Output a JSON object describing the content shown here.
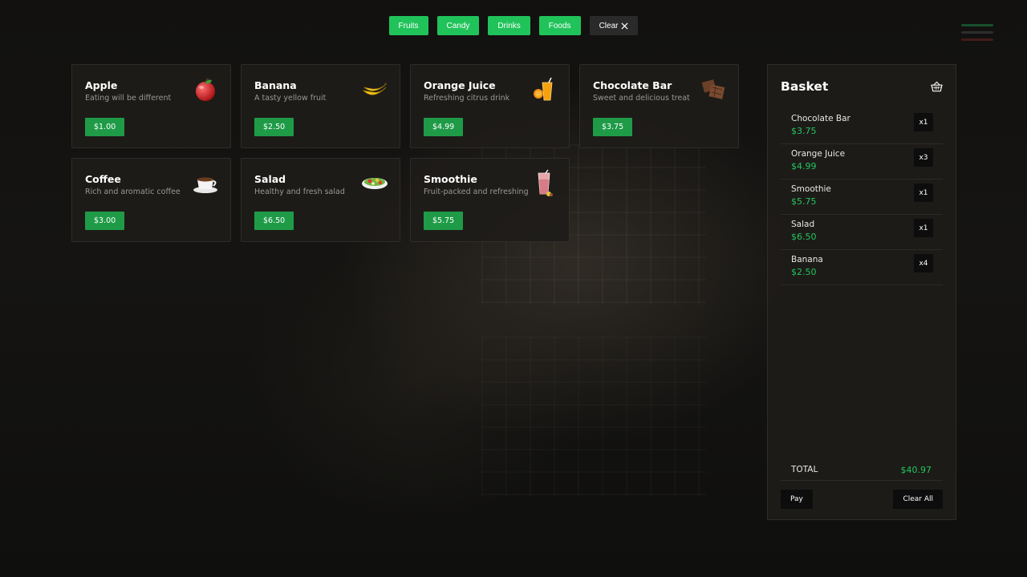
{
  "filters": [
    {
      "label": "Fruits"
    },
    {
      "label": "Candy"
    },
    {
      "label": "Drinks"
    },
    {
      "label": "Foods"
    }
  ],
  "clear_filter_label": "Clear",
  "products": [
    {
      "name": "Apple",
      "description": "Eating will be different",
      "price": "$1.00",
      "icon": "apple-icon"
    },
    {
      "name": "Banana",
      "description": "A tasty yellow fruit",
      "price": "$2.50",
      "icon": "banana-icon"
    },
    {
      "name": "Orange Juice",
      "description": "Refreshing citrus drink",
      "price": "$4.99",
      "icon": "orange-juice-icon"
    },
    {
      "name": "Chocolate Bar",
      "description": "Sweet and delicious treat",
      "price": "$3.75",
      "icon": "chocolate-icon"
    },
    {
      "name": "Coffee",
      "description": "Rich and aromatic coffee",
      "price": "$3.00",
      "icon": "coffee-icon"
    },
    {
      "name": "Salad",
      "description": "Healthy and fresh salad",
      "price": "$6.50",
      "icon": "salad-icon"
    },
    {
      "name": "Smoothie",
      "description": "Fruit-packed and refreshing",
      "price": "$5.75",
      "icon": "smoothie-icon"
    }
  ],
  "basket": {
    "title": "Basket",
    "icon": "basket-icon",
    "items": [
      {
        "name": "Chocolate Bar",
        "price": "$3.75",
        "qty": "x1"
      },
      {
        "name": "Orange Juice",
        "price": "$4.99",
        "qty": "x3"
      },
      {
        "name": "Smoothie",
        "price": "$5.75",
        "qty": "x1"
      },
      {
        "name": "Salad",
        "price": "$6.50",
        "qty": "x1"
      },
      {
        "name": "Banana",
        "price": "$2.50",
        "qty": "x4"
      }
    ],
    "total_label": "TOTAL",
    "total_value": "$40.97",
    "pay_label": "Pay",
    "clear_all_label": "Clear All"
  },
  "colors": {
    "accent_green": "#20c35a",
    "price_button_green": "#1f9b48",
    "price_text_green": "#22c55e",
    "panel_bg": "#1e1c19"
  }
}
